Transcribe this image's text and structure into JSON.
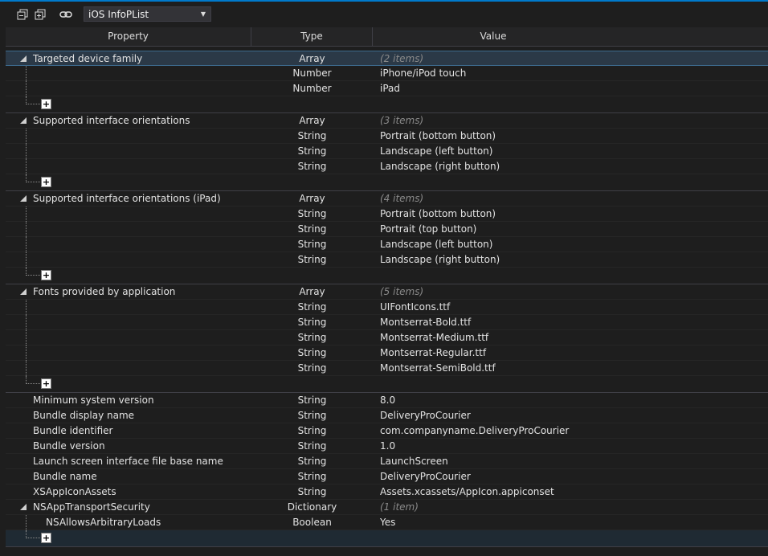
{
  "toolbar": {
    "editor_selector": "iOS InfoPList",
    "icons": [
      "collapse-all-icon",
      "expand-all-icon",
      "link-icon"
    ]
  },
  "columns": {
    "property": "Property",
    "type": "Type",
    "value": "Value"
  },
  "groups": {
    "targeted": {
      "property": "Targeted device family",
      "type": "Array",
      "value": "(2 items)",
      "items": [
        {
          "type": "Number",
          "value": "iPhone/iPod touch"
        },
        {
          "type": "Number",
          "value": "iPad"
        }
      ]
    },
    "orient": {
      "property": "Supported interface orientations",
      "type": "Array",
      "value": "(3 items)",
      "items": [
        {
          "type": "String",
          "value": "Portrait (bottom button)"
        },
        {
          "type": "String",
          "value": "Landscape (left button)"
        },
        {
          "type": "String",
          "value": "Landscape (right button)"
        }
      ]
    },
    "orient_ipad": {
      "property": "Supported interface orientations (iPad)",
      "type": "Array",
      "value": "(4 items)",
      "items": [
        {
          "type": "String",
          "value": "Portrait (bottom button)"
        },
        {
          "type": "String",
          "value": "Portrait (top button)"
        },
        {
          "type": "String",
          "value": "Landscape (left button)"
        },
        {
          "type": "String",
          "value": "Landscape (right button)"
        }
      ]
    },
    "fonts": {
      "property": "Fonts provided by application",
      "type": "Array",
      "value": "(5 items)",
      "items": [
        {
          "type": "String",
          "value": "UIFontIcons.ttf"
        },
        {
          "type": "String",
          "value": "Montserrat-Bold.ttf"
        },
        {
          "type": "String",
          "value": "Montserrat-Medium.ttf"
        },
        {
          "type": "String",
          "value": "Montserrat-Regular.ttf"
        },
        {
          "type": "String",
          "value": "Montserrat-SemiBold.ttf"
        }
      ]
    },
    "ats": {
      "property": "NSAppTransportSecurity",
      "type": "Dictionary",
      "value": "(1 item)",
      "items": [
        {
          "property": "NSAllowsArbitraryLoads",
          "type": "Boolean",
          "value": "Yes"
        }
      ]
    }
  },
  "simple": [
    {
      "property": "Minimum system version",
      "type": "String",
      "value": "8.0"
    },
    {
      "property": "Bundle display name",
      "type": "String",
      "value": "DeliveryProCourier"
    },
    {
      "property": "Bundle identifier",
      "type": "String",
      "value": "com.companyname.DeliveryProCourier"
    },
    {
      "property": "Bundle version",
      "type": "String",
      "value": "1.0"
    },
    {
      "property": "Launch screen interface file base name",
      "type": "String",
      "value": "LaunchScreen"
    },
    {
      "property": "Bundle name",
      "type": "String",
      "value": "DeliveryProCourier"
    },
    {
      "property": "XSAppIconAssets",
      "type": "String",
      "value": "Assets.xcassets/AppIcon.appiconset"
    }
  ],
  "add_button": "+"
}
